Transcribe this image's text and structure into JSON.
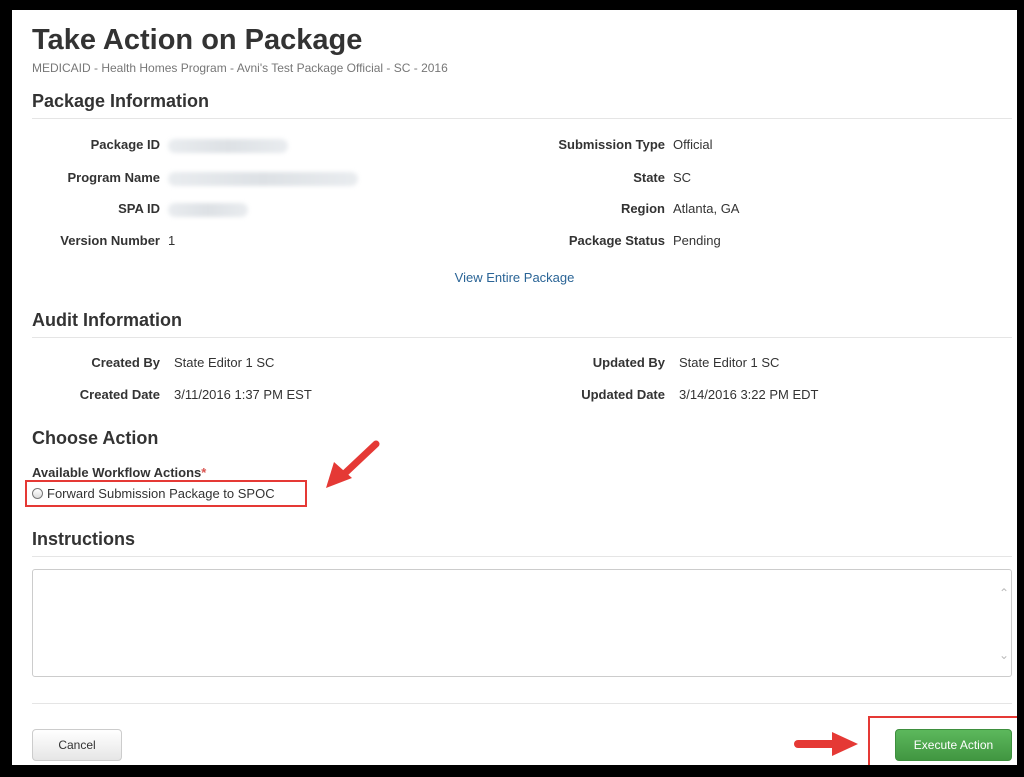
{
  "page": {
    "title": "Take Action on Package",
    "subtitle": "MEDICAID - Health Homes Program - Avni's Test Package Official - SC - 2016"
  },
  "package_info": {
    "heading": "Package Information",
    "left": [
      {
        "label": "Package ID",
        "value": ""
      },
      {
        "label": "Program Name",
        "value": ""
      },
      {
        "label": "SPA ID",
        "value": ""
      },
      {
        "label": "Version Number",
        "value": "1"
      }
    ],
    "right": [
      {
        "label": "Submission Type",
        "value": "Official"
      },
      {
        "label": "State",
        "value": "SC"
      },
      {
        "label": "Region",
        "value": "Atlanta, GA"
      },
      {
        "label": "Package Status",
        "value": "Pending"
      }
    ],
    "view_link": "View Entire Package"
  },
  "audit_info": {
    "heading": "Audit Information",
    "created_by_label": "Created By",
    "created_by": "State Editor 1 SC",
    "created_date_label": "Created Date",
    "created_date": "3/11/2016 1:37 PM EST",
    "updated_by_label": "Updated By",
    "updated_by": "State Editor 1 SC",
    "updated_date_label": "Updated Date",
    "updated_date": "3/14/2016 3:22 PM EDT"
  },
  "choose_action": {
    "heading": "Choose Action",
    "field_label": "Available Workflow Actions",
    "required_marker": "*",
    "option": "Forward Submission Package to SPOC"
  },
  "instructions": {
    "heading": "Instructions",
    "value": ""
  },
  "buttons": {
    "cancel": "Cancel",
    "execute": "Execute Action"
  },
  "colors": {
    "annotation": "#e53935",
    "execute_button": "#5cb85c",
    "link": "#2a6496"
  }
}
